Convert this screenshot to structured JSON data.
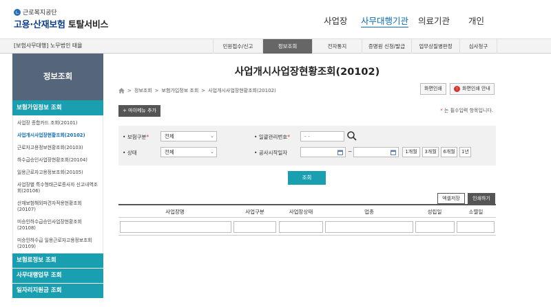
{
  "header": {
    "org_name": "근로복지공단",
    "logo_mark": "ㄴ",
    "service_name_blue": "고용·산재보험",
    "service_name_dark": "토탈서비스",
    "nav": [
      "사업장",
      "사무대행기관",
      "의료기관",
      "개인"
    ],
    "active_nav": "사무대행기관"
  },
  "subbar": {
    "user_label": "[보험사무대행] 노무법인 태율",
    "tabs": [
      "민원접수/신고",
      "정보조회",
      "전자통지",
      "증명원 신청/발급",
      "업무상질병판정",
      "심사청구"
    ],
    "active_tab": "정보조회"
  },
  "sidebar": {
    "header": "정보조회",
    "sections": [
      {
        "label": "보험가입정보 조회",
        "items": [
          "사업장 종합카드 조회(20101)",
          "사업개시사업장현황조회(20102)",
          "근로자고용정보현황조회(20103)",
          "하수급승인사업장현황조회(20104)",
          "일용근로자고용정보조회(20105)",
          "사업장별 특수형태근로종사자 신고내역조회(20106)",
          "산재보험해외파견자적용현황조회 (20107)",
          "미승인하수급승인사업장현황조회 (20108)",
          "미승인하수급 일용근로자고용정보조회(20109)"
        ],
        "active_item": "사업개시사업장현황조회(20102)"
      }
    ],
    "other_sections": [
      "보험료정보 조회",
      "사무대행업무 조회",
      "일자리지원금 조회"
    ]
  },
  "main": {
    "title": "사업개시사업장현황조회(20102)",
    "breadcrumb": [
      "정보조회",
      "보험가입정보 조회",
      "사업개시사업장현황조회(20102)"
    ],
    "breadcrumb_sep": ">",
    "print_button": "화면인쇄",
    "print_guide_button": "화면인쇄 안내",
    "info_icon_glyph": "!",
    "mymenu_button": "+ 마이메뉴 추가",
    "required_note": "는 필수입력 항목입니다.",
    "required_mark": "*"
  },
  "search": {
    "insurance_type_label": "보험구분",
    "insurance_type_value": "전체",
    "mgmt_no_label": "일괄관리번호",
    "mgmt_no_placeholder": "-    -",
    "status_label": "상태",
    "status_value": "전체",
    "start_date_label": "공사시작일자",
    "date_sep": "~",
    "period_buttons": [
      "1개월",
      "3개월",
      "6개월",
      "1년"
    ],
    "query_button": "조회"
  },
  "table": {
    "excel_button": "엑셀저장",
    "print_button": "인쇄하기",
    "columns": [
      "사업장명",
      "사업구분",
      "사업장상태",
      "업종",
      "성립일",
      "소멸일"
    ]
  },
  "colors": {
    "teal": "#1a9fb0",
    "navy": "#0e3f8a",
    "side_head": "#55657a",
    "required": "#d9342b"
  }
}
